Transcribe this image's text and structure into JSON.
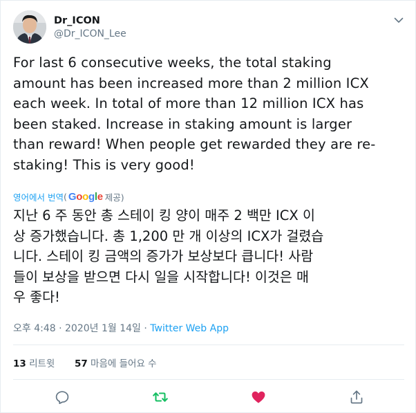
{
  "author": {
    "name": "Dr_ICON",
    "handle": "@Dr_ICON_Lee"
  },
  "tweet": {
    "text_en": "For last 6 consecutive weeks, the total staking\namount has been increased more than 2 million ICX\neach week. In total of more than 12 million ICX has\nbeen staked. Increase in staking amount is larger\nthan reward! When people get rewarded they are re-\nstaking! This is very good!",
    "translate_prefix": "영어에서 번역",
    "translate_open": "(",
    "translate_provider": "Google",
    "translate_suffix": "제공)",
    "text_ko": "지난 6 주 동안 총 스테이 킹 양이 매주 2 백만 ICX 이\n상 증가했습니다. 총 1,200 만 개 이상의 ICX가 걸렸습\n니다. 스테이 킹 금액의 증가가 보상보다 큽니다! 사람\n들이 보상을 받으면 다시 일을 시작합니다! 이것은 매\n우 좋다!",
    "time": "오후 4:48",
    "date": "2020년 1월 14일",
    "separator": "·",
    "source": "Twitter Web App"
  },
  "stats": {
    "retweets_count": "13",
    "retweets_label": "리트윗",
    "likes_count": "57",
    "likes_label": "마음에 들어요 수"
  },
  "icons": {
    "reply": "comment-bubble-icon",
    "retweet": "retweet-arrows-icon",
    "like": "heart-icon",
    "share": "share-upload-icon",
    "menu": "chevron-down-icon"
  },
  "colors": {
    "text": "#14171a",
    "secondary": "#657786",
    "link": "#1da1f2",
    "retweet": "#17bf63",
    "like": "#e0245e",
    "border": "#e6ecf0"
  }
}
